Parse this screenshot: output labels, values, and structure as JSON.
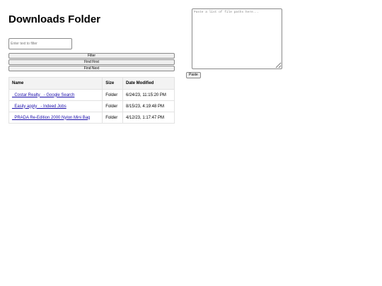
{
  "page": {
    "title": "Downloads Folder"
  },
  "filter": {
    "placeholder": "Enter text to filter",
    "value": ""
  },
  "buttons": {
    "filter_label": "Filter",
    "find_first_label": "Find First",
    "find_next_label": "Find Next",
    "paste_label": "Paste"
  },
  "table": {
    "headers": {
      "name": "Name",
      "size": "Size",
      "modified": "Date Modified"
    },
    "rows": [
      {
        "name": "_Costar Realty_ - Google Search",
        "size": "Folder",
        "modified": "6/24/23, 11:15:20 PM"
      },
      {
        "name": "_Easily apply_ - Indeed Jobs",
        "size": "Folder",
        "modified": "8/15/23, 4:19:48 PM"
      },
      {
        "name": "_PRADA Re-Edition 2000 Nylon Mini Bag",
        "size": "Folder",
        "modified": "4/12/23, 1:17:47 PM"
      }
    ]
  },
  "paths_input": {
    "placeholder": "Paste a list of file paths here...",
    "value": ""
  }
}
